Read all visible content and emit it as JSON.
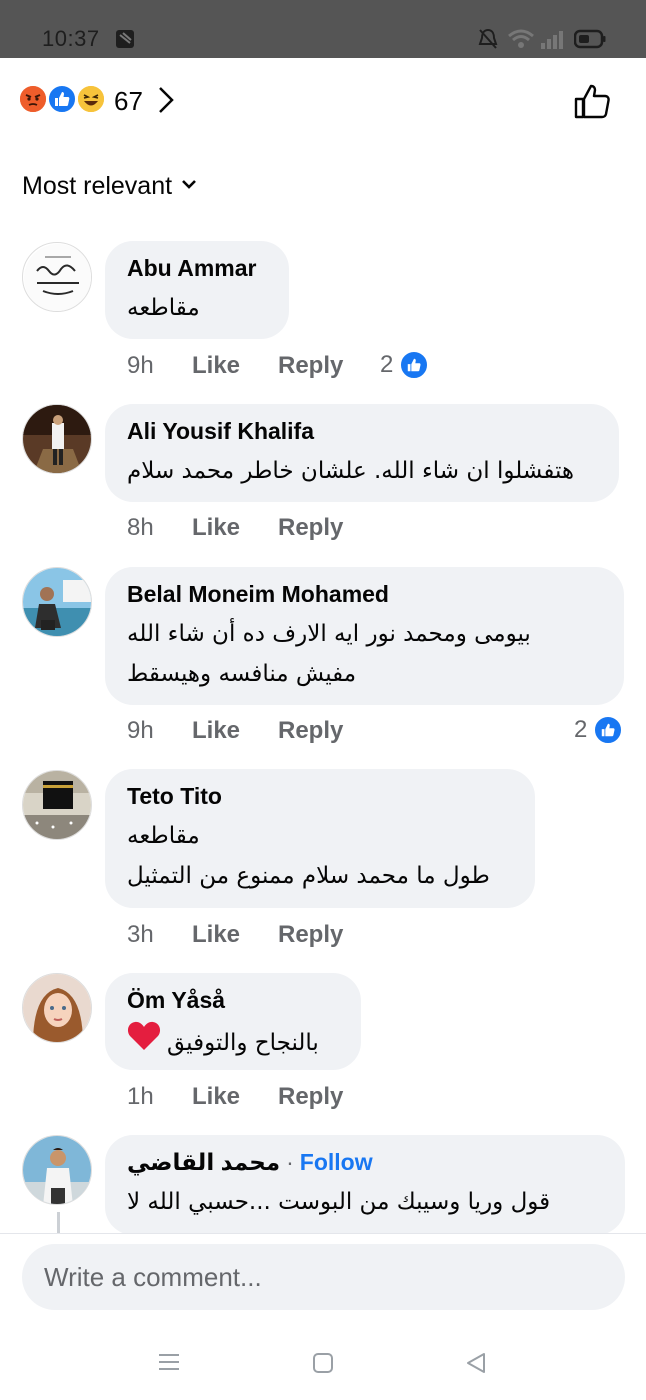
{
  "status_bar": {
    "time": "10:37",
    "icons": [
      "notification-icon",
      "silent-bell-icon",
      "wifi-icon",
      "signal-icon",
      "battery-icon"
    ]
  },
  "reactions": {
    "icons": [
      "angry-reaction-icon",
      "like-reaction-icon",
      "haha-reaction-icon"
    ],
    "count": "67"
  },
  "sort": {
    "label": "Most relevant"
  },
  "comments": [
    {
      "author": "Abu Ammar",
      "text": [
        "مقاطعه"
      ],
      "time": "9h",
      "like_label": "Like",
      "reply_label": "Reply",
      "likes": "2"
    },
    {
      "author": "Ali Yousif Khalifa",
      "text": [
        "هتفشلوا  ان شاء الله. علشان خاطر محمد سلام"
      ],
      "time": "8h",
      "like_label": "Like",
      "reply_label": "Reply"
    },
    {
      "author": "Belal Moneim Mohamed",
      "text": [
        "بيومى ومحمد نور ايه الارف ده أن شاء الله",
        "مفيش منافسه وهيسقط"
      ],
      "time": "9h",
      "like_label": "Like",
      "reply_label": "Reply",
      "likes": "2"
    },
    {
      "author": "Teto Tito",
      "text": [
        "مقاطعه",
        "طول ما محمد سلام ممنوع من التمثيل"
      ],
      "time": "3h",
      "like_label": "Like",
      "reply_label": "Reply"
    },
    {
      "author": "Öm Yåså",
      "text": [
        "بالنجاح والتوفيق"
      ],
      "time": "1h",
      "like_label": "Like",
      "reply_label": "Reply"
    },
    {
      "author": "محمد القاضي",
      "follow_label": "Follow",
      "text": [
        "قول وريا وسيبك من البوست ...حسبي الله لا"
      ]
    }
  ],
  "composer": {
    "placeholder": "Write a comment..."
  },
  "colors": {
    "brand_blue": "#1877f2",
    "bubble_bg": "#f0f2f5",
    "secondary_text": "#65676b",
    "heart_red": "#e41e3f"
  }
}
